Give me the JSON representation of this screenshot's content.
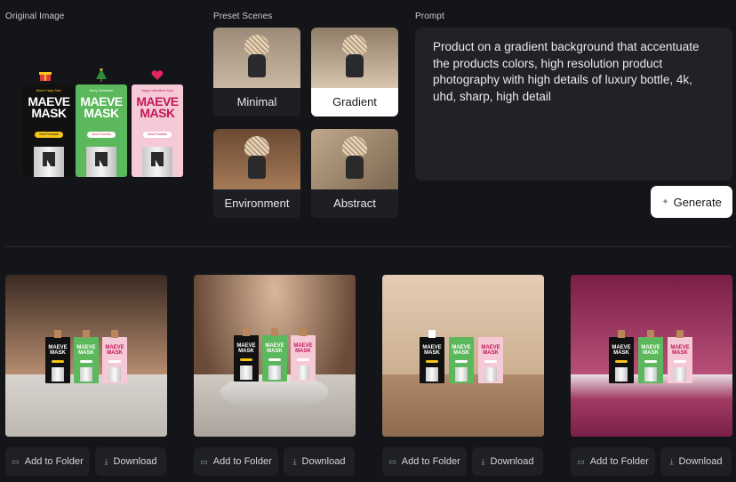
{
  "sections": {
    "original": "Original Image",
    "presets": "Preset Scenes",
    "prompt": "Prompt"
  },
  "original_boxes": [
    {
      "tag": "Black Friday Sale!",
      "brand_line1": "MAEVE",
      "brand_line2": "MASK",
      "pill": "View Products",
      "bg": "#111111",
      "fg": "#ffffff",
      "pill_bg": "#f5c518",
      "pill_fg": "#111111",
      "icon": "gift-icon"
    },
    {
      "tag": "Merry Christmas!",
      "brand_line1": "MAEVE",
      "brand_line2": "MASK",
      "pill": "View Products",
      "bg": "#5cb85c",
      "fg": "#ffffff",
      "pill_bg": "#ffffff",
      "pill_fg": "#d94040",
      "icon": "christmas-tree-icon"
    },
    {
      "tag": "Happy Valentine's Day!",
      "brand_line1": "MAEVE",
      "brand_line2": "MASK",
      "pill": "View Products",
      "bg": "#f6c9d6",
      "fg": "#c2185b",
      "pill_bg": "#ffffff",
      "pill_fg": "#c2185b",
      "icon": "hearts-icon"
    }
  ],
  "scenes": [
    {
      "label": "Minimal",
      "active": false
    },
    {
      "label": "Gradient",
      "active": true
    },
    {
      "label": "Environment",
      "active": false
    },
    {
      "label": "Abstract",
      "active": false
    }
  ],
  "prompt": {
    "text": "Product on a gradient background that accentuate the products colors, high resolution product photography with high details of luxury bottle, 4k, uhd, sharp, high detail"
  },
  "generate": {
    "label": "Generate",
    "icon": "sparkle-icon"
  },
  "results": [
    {
      "add_label": "Add to Folder",
      "download_label": "Download",
      "add_icon": "folder-icon",
      "download_icon": "download-icon"
    },
    {
      "add_label": "Add to Folder",
      "download_label": "Download",
      "add_icon": "folder-icon",
      "download_icon": "download-icon"
    },
    {
      "add_label": "Add to Folder",
      "download_label": "Download",
      "add_icon": "folder-icon",
      "download_icon": "download-icon"
    },
    {
      "add_label": "Add to Folder",
      "download_label": "Download",
      "add_icon": "folder-icon",
      "download_icon": "download-icon"
    }
  ]
}
